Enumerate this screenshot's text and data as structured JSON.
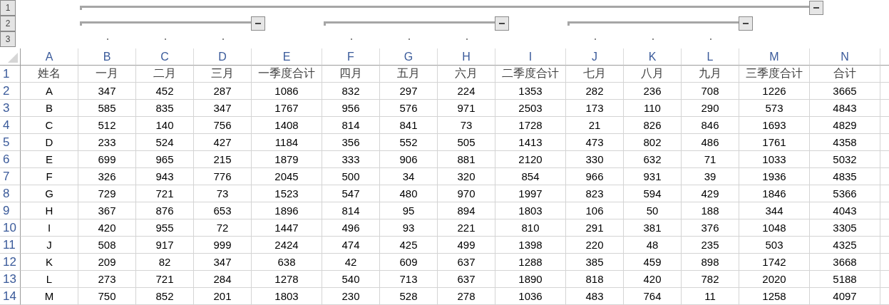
{
  "outline": {
    "levels": [
      "1",
      "2",
      "3"
    ],
    "groups": [
      {
        "expanded": true,
        "children": [
          {
            "expanded": true
          },
          {
            "expanded": true
          },
          {
            "expanded": true
          }
        ]
      }
    ]
  },
  "columns": [
    {
      "letter": "A",
      "kind": "detail0"
    },
    {
      "letter": "B",
      "kind": "detail"
    },
    {
      "letter": "C",
      "kind": "detail"
    },
    {
      "letter": "D",
      "kind": "detail"
    },
    {
      "letter": "E",
      "kind": "summary"
    },
    {
      "letter": "F",
      "kind": "detail"
    },
    {
      "letter": "G",
      "kind": "detail"
    },
    {
      "letter": "H",
      "kind": "detail"
    },
    {
      "letter": "I",
      "kind": "summary"
    },
    {
      "letter": "J",
      "kind": "detail"
    },
    {
      "letter": "K",
      "kind": "detail"
    },
    {
      "letter": "L",
      "kind": "detail"
    },
    {
      "letter": "M",
      "kind": "summary"
    },
    {
      "letter": "N",
      "kind": "summary"
    }
  ],
  "rows": [
    {
      "number": "1",
      "cells": [
        "姓名",
        "一月",
        "二月",
        "三月",
        "一季度合计",
        "四月",
        "五月",
        "六月",
        "二季度合计",
        "七月",
        "八月",
        "九月",
        "三季度合计",
        "合计"
      ]
    },
    {
      "number": "2",
      "cells": [
        "A",
        "347",
        "452",
        "287",
        "1086",
        "832",
        "297",
        "224",
        "1353",
        "282",
        "236",
        "708",
        "1226",
        "3665"
      ]
    },
    {
      "number": "3",
      "cells": [
        "B",
        "585",
        "835",
        "347",
        "1767",
        "956",
        "576",
        "971",
        "2503",
        "173",
        "110",
        "290",
        "573",
        "4843"
      ]
    },
    {
      "number": "4",
      "cells": [
        "C",
        "512",
        "140",
        "756",
        "1408",
        "814",
        "841",
        "73",
        "1728",
        "21",
        "826",
        "846",
        "1693",
        "4829"
      ]
    },
    {
      "number": "5",
      "cells": [
        "D",
        "233",
        "524",
        "427",
        "1184",
        "356",
        "552",
        "505",
        "1413",
        "473",
        "802",
        "486",
        "1761",
        "4358"
      ]
    },
    {
      "number": "6",
      "cells": [
        "E",
        "699",
        "965",
        "215",
        "1879",
        "333",
        "906",
        "881",
        "2120",
        "330",
        "632",
        "71",
        "1033",
        "5032"
      ]
    },
    {
      "number": "7",
      "cells": [
        "F",
        "326",
        "943",
        "776",
        "2045",
        "500",
        "34",
        "320",
        "854",
        "966",
        "931",
        "39",
        "1936",
        "4835"
      ]
    },
    {
      "number": "8",
      "cells": [
        "G",
        "729",
        "721",
        "73",
        "1523",
        "547",
        "480",
        "970",
        "1997",
        "823",
        "594",
        "429",
        "1846",
        "5366"
      ]
    },
    {
      "number": "9",
      "cells": [
        "H",
        "367",
        "876",
        "653",
        "1896",
        "814",
        "95",
        "894",
        "1803",
        "106",
        "50",
        "188",
        "344",
        "4043"
      ]
    },
    {
      "number": "10",
      "cells": [
        "I",
        "420",
        "955",
        "72",
        "1447",
        "496",
        "93",
        "221",
        "810",
        "291",
        "381",
        "376",
        "1048",
        "3305"
      ]
    },
    {
      "number": "11",
      "cells": [
        "J",
        "508",
        "917",
        "999",
        "2424",
        "474",
        "425",
        "499",
        "1398",
        "220",
        "48",
        "235",
        "503",
        "4325"
      ]
    },
    {
      "number": "12",
      "cells": [
        "K",
        "209",
        "82",
        "347",
        "638",
        "42",
        "609",
        "637",
        "1288",
        "385",
        "459",
        "898",
        "1742",
        "3668"
      ]
    },
    {
      "number": "13",
      "cells": [
        "L",
        "273",
        "721",
        "284",
        "1278",
        "540",
        "713",
        "637",
        "1890",
        "818",
        "420",
        "782",
        "2020",
        "5188"
      ]
    },
    {
      "number": "14",
      "cells": [
        "M",
        "750",
        "852",
        "201",
        "1803",
        "230",
        "528",
        "278",
        "1036",
        "483",
        "764",
        "11",
        "1258",
        "4097"
      ]
    }
  ]
}
